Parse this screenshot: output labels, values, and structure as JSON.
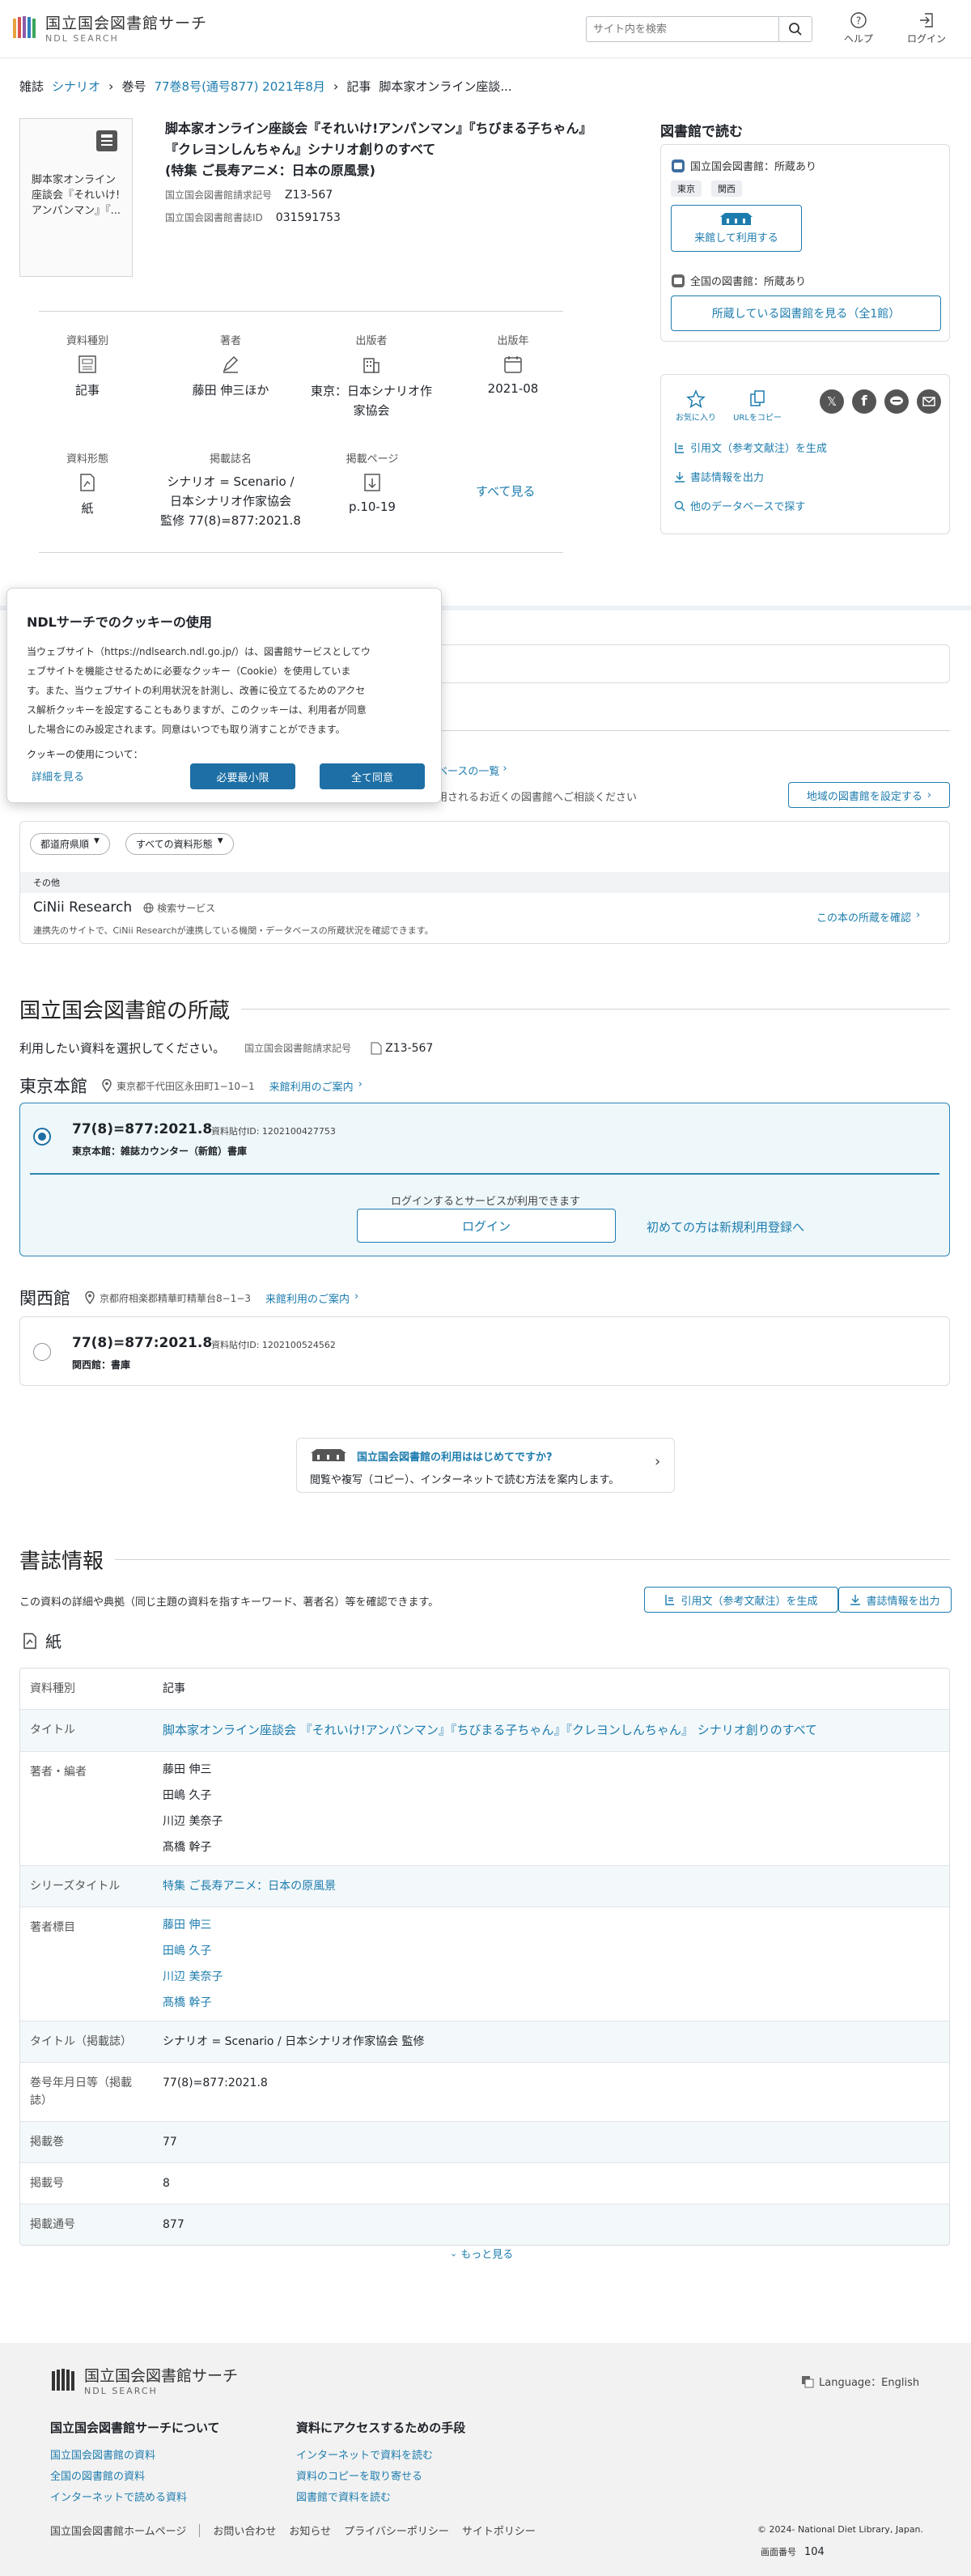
{
  "header": {
    "logo_ja": "国立国会図書館サーチ",
    "logo_en": "NDL SEARCH",
    "search_placeholder": "サイト内を検索",
    "help": "ヘルプ",
    "login": "ログイン"
  },
  "breadcrumb": {
    "c1": "雑誌",
    "c2": "シナリオ",
    "c3": "巻号",
    "c4": "77巻8号(通号877) 2021年8月",
    "c5": "記事",
    "c6": "脚本家オンライン座談..."
  },
  "item": {
    "thumb_text": "脚本家オンライン座談会『それいけ!アンパンマン』『...",
    "title_l1": "脚本家オンライン座談会『それいけ!アンパンマン』『ちびまる子ちゃん』",
    "title_l2": "『クレヨンしんちゃん』シナリオ創りのすべて",
    "title_l3": "(特集 ご長寿アニメ：日本の原風景)",
    "callno_label": "国立国会図書館請求記号",
    "callno": "Z13-567",
    "bibid_label": "国立国会図書館書誌ID",
    "bibid": "031591753"
  },
  "facts": {
    "type_label": "資料種別",
    "type": "記事",
    "author_label": "著者",
    "author": "藤田 伸三ほか",
    "publisher_label": "出版者",
    "publisher_l1": "東京：日本シナリオ作",
    "publisher_l2": "家協会",
    "year_label": "出版年",
    "year": "2021-08",
    "form_label": "資料形態",
    "form": "紙",
    "journal_label": "掲載誌名",
    "journal_l1": "シナリオ = Scenario /",
    "journal_l2": "日本シナリオ作家協会",
    "journal_l3": "監修 77(8)=877:2021.8",
    "page_label": "掲載ページ",
    "page": "p.10-19",
    "see_all": "すべて見る"
  },
  "side": {
    "title": "図書館で読む",
    "ndl": "国立国会図書館：所蔵あり",
    "tag1": "東京",
    "tag2": "関西",
    "visit": "来館して利用する",
    "all": "全国の図書館：所蔵あり",
    "all_btn": "所蔵している図書館を見る（全1館）",
    "fav": "お気に入り",
    "copy_url": "URLをコピー",
    "cite": "引用文（参考文献注）を生成",
    "export": "書誌情報を出力",
    "other_db": "他のデータベースで探す"
  },
  "cookie": {
    "title": "NDLサーチでのクッキーの使用",
    "b1": "当ウェブサイト（https://ndlsearch.ndl.go.jp/）は、図書館サービスとしてウ",
    "b2": "ェブサイトを機能させるために必要なクッキー（Cookie）を使用していま",
    "b3": "す。また、当ウェブサイトの利用状況を計測し、改善に役立てるためのアクセ",
    "b4": "ス解析クッキーを設定することもありますが、このクッキーは、利用者が同意",
    "b5": "した場合にのみ設定されます。同意はいつでも取り消すことができます。",
    "usage": "クッキーの使用について：",
    "details": "詳細を見る",
    "minimum": "必要最小限",
    "accept": "全て同意"
  },
  "libs": {
    "list_link": "ベースの一覧",
    "note": "用されるお近くの図書館へご相談ください",
    "region_btn": "地域の図書館を設定する",
    "f_pref": "都道府県順",
    "f_type": "すべての資料形態",
    "other": "その他",
    "cinii": "CiNii Research",
    "cinii_tag": "検索サービス",
    "cinii_desc": "連携先のサイトで、CiNii Researchが連携している機関・データベースの所蔵状況を確認できます。",
    "cinii_link": "この本の所蔵を確認"
  },
  "ndl_holdings": {
    "title": "国立国会図書館の所蔵",
    "intro": "利用したい資料を選択してください。",
    "callno_label": "国立国会図書館請求記号",
    "callno": "Z13-567",
    "tokyo": "東京本館",
    "tokyo_addr": "東京都千代田区永田町1−10−1",
    "tokyo_guide": "来館利用のご案内",
    "t_vol": "77(8)=877:2021.8",
    "t_id": "資料貼付ID: 1202100427753",
    "t_loc": "東京本館：雑誌カウンター（新館）書庫",
    "login_note": "ログインするとサービスが利用できます",
    "login_btn": "ログイン",
    "register": "初めての方は新規利用登録へ",
    "kansai": "関西館",
    "kansai_addr": "京都府相楽郡精華町精華台8−1−3",
    "kansai_guide": "来館利用のご案内",
    "k_vol": "77(8)=877:2021.8",
    "k_id": "資料貼付ID: 1202100524562",
    "k_loc": "関西館：書庫",
    "first_title": "国立国会図書館の利用ははじめてですか?",
    "first_desc": "閲覧や複写（コピー）、インターネットで読む方法を案内します。"
  },
  "bib": {
    "title": "書誌情報",
    "intro": "この資料の詳細や典拠（同じ主題の資料を指すキーワード、著者名）等を確認できます。",
    "cite": "引用文（参考文献注）を生成",
    "export": "書誌情報を出力",
    "form": "紙",
    "k1": "資料種別",
    "v1": "記事",
    "k2": "タイトル",
    "v2": "脚本家オンライン座談会 『それいけ!アンパンマン』『ちびまる子ちゃん』『クレヨンしんちゃん』 シナリオ創りのすべて",
    "k3": "著者・編者",
    "a1": "藤田 伸三",
    "a2": "田嶋 久子",
    "a3": "川辺 美奈子",
    "a4": "髙橋 幹子",
    "k4": "シリーズタイトル",
    "v4": "特集 ご長寿アニメ：日本の原風景",
    "k5": "著者標目",
    "h1": "藤田 伸三",
    "h2": "田嶋 久子",
    "h3": "川辺 美奈子",
    "h4": "髙橋 幹子",
    "k6": "タイトル（掲載誌）",
    "v6": "シナリオ = Scenario / 日本シナリオ作家協会 監修",
    "k7a": "巻号年月日等（掲載",
    "k7b": "誌）",
    "v7": "77(8)=877:2021.8",
    "k8": "掲載巻",
    "v8": "77",
    "k9": "掲載号",
    "v9": "8",
    "k10": "掲載通号",
    "v10": "877",
    "more": "もっと見る"
  },
  "footer": {
    "logo_ja": "国立国会図書館サーチ",
    "logo_en": "NDL SEARCH",
    "language": "Language：English",
    "about": "国立国会図書館サーチについて",
    "a1": "国立国会図書館の資料",
    "a2": "全国の図書館の資料",
    "a3": "インターネットで読める資料",
    "access": "資料にアクセスするための手段",
    "b1": "インターネットで資料を読む",
    "b2": "資料のコピーを取り寄せる",
    "b3": "図書館で資料を読む",
    "l1": "国立国会図書館ホームページ",
    "l2": "お問い合わせ",
    "l3": "お知らせ",
    "l4": "プライバシーポリシー",
    "l5": "サイトポリシー",
    "copyright": "© 2024- National Diet Library, Japan.",
    "screen_label": "画面番号",
    "screen_no": "104"
  }
}
